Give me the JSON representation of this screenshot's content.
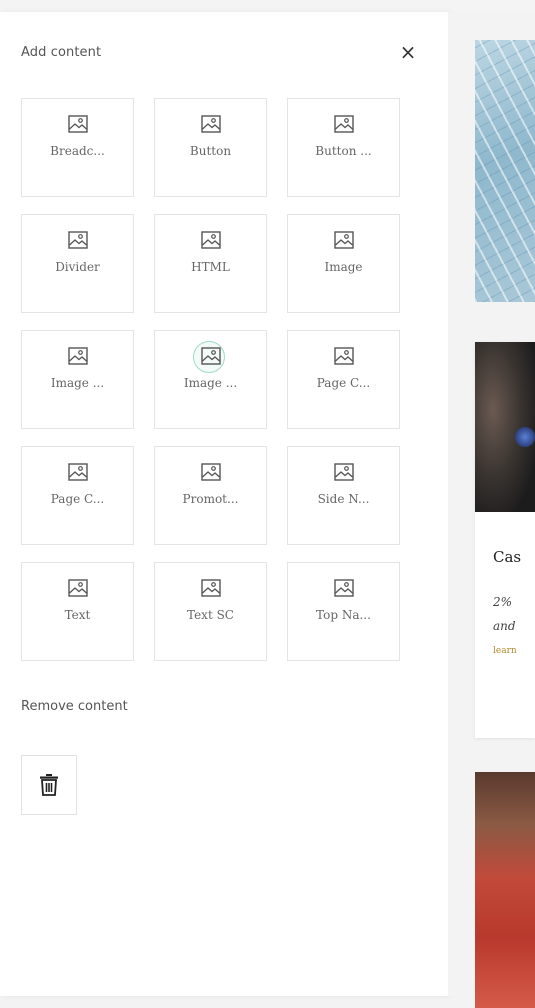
{
  "panel": {
    "title": "Add content",
    "close_symbol": "×",
    "tiles": [
      {
        "label": "Breadc...",
        "icon": "image-icon"
      },
      {
        "label": "Button",
        "icon": "image-icon"
      },
      {
        "label": "Button ...",
        "icon": "image-icon"
      },
      {
        "label": "Divider",
        "icon": "image-icon"
      },
      {
        "label": "HTML",
        "icon": "image-icon"
      },
      {
        "label": "Image",
        "icon": "image-icon"
      },
      {
        "label": "Image ...",
        "icon": "image-icon"
      },
      {
        "label": "Image ...",
        "icon": "image-icon"
      },
      {
        "label": "Page C...",
        "icon": "image-icon"
      },
      {
        "label": "Page C...",
        "icon": "image-icon"
      },
      {
        "label": "Promot...",
        "icon": "image-icon"
      },
      {
        "label": "Side N...",
        "icon": "image-icon"
      },
      {
        "label": "Text",
        "icon": "image-icon"
      },
      {
        "label": "Text SC",
        "icon": "image-icon"
      },
      {
        "label": "Top Na...",
        "icon": "image-icon"
      }
    ],
    "remove_title": "Remove content",
    "remove_icon": "trash-icon"
  },
  "preview": {
    "card2": {
      "heading": "Cas",
      "line1": "2%",
      "line2": "and",
      "link": "learn"
    }
  },
  "colors": {
    "panel_bg": "#ffffff",
    "page_bg": "#f3f3f3",
    "tile_border": "#e4e4e4",
    "link_accent": "#b08a2a",
    "hover_ring": "#9fdcc3"
  }
}
